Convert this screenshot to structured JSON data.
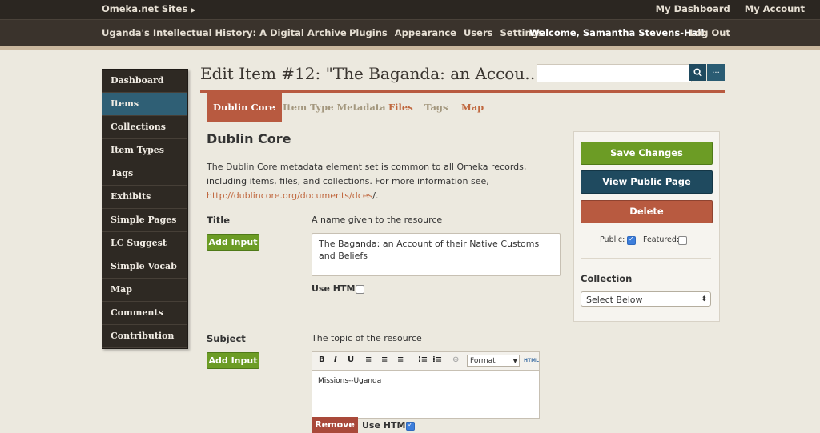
{
  "topbar": {
    "sites_label": "Omeka.net Sites",
    "sites_arrow": "▶",
    "my_dashboard": "My Dashboard",
    "my_account": "My Account"
  },
  "subbar": {
    "site_title": "Uganda's Intellectual History: A Digital Archive",
    "nav": [
      "Plugins",
      "Appearance",
      "Users",
      "Settings"
    ],
    "welcome": "Welcome, Samantha Stevens-Hall",
    "logout": "Log Out"
  },
  "sidebar": {
    "items": [
      {
        "label": "Dashboard"
      },
      {
        "label": "Items"
      },
      {
        "label": "Collections"
      },
      {
        "label": "Item Types"
      },
      {
        "label": "Tags"
      },
      {
        "label": "Exhibits"
      },
      {
        "label": "Simple Pages"
      },
      {
        "label": "LC Suggest"
      },
      {
        "label": "Simple Vocab"
      },
      {
        "label": "Map"
      },
      {
        "label": "Comments"
      },
      {
        "label": "Contribution"
      }
    ],
    "active_index": 1
  },
  "page": {
    "title": "Edit Item #12: \"The Baganda: an Accou…",
    "search_placeholder": "",
    "search_icon": "search-icon",
    "more_label": "..."
  },
  "tabs": [
    {
      "label": "Dublin Core"
    },
    {
      "label": "Item Type Metadata"
    },
    {
      "label": "Files"
    },
    {
      "label": "Tags"
    },
    {
      "label": "Map"
    }
  ],
  "section": {
    "title": "Dublin Core",
    "desc_before": "The Dublin Core metadata element set is common to all Omeka records, including items, files, and collections. For more information see, ",
    "desc_link": "http://dublincore.org/documents/dces",
    "desc_after": "/."
  },
  "fields": {
    "title": {
      "label": "Title",
      "hint": "A name given to the resource",
      "add_input": "Add Input",
      "value": "The Baganda: an Account of their Native Customs and Beliefs",
      "use_html": "Use HTML",
      "use_html_checked": false
    },
    "subject": {
      "label": "Subject",
      "hint": "The topic of the resource",
      "add_input": "Add Input",
      "value": "Missions--Uganda",
      "format_label": "Format",
      "html_label": "HTML",
      "remove": "Remove",
      "use_html": "Use HTML",
      "use_html_checked": true
    }
  },
  "panel": {
    "save": "Save Changes",
    "view_public": "View Public Page",
    "delete": "Delete",
    "public_label": "Public:",
    "public_checked": true,
    "featured_label": "Featured:",
    "featured_checked": false,
    "collection_label": "Collection",
    "collection_value": "Select Below"
  },
  "colors": {
    "accent_red": "#b85a40",
    "accent_green": "#6c9c25",
    "accent_blue": "#1f4a5f",
    "sidebar_active": "#2f5f75"
  }
}
